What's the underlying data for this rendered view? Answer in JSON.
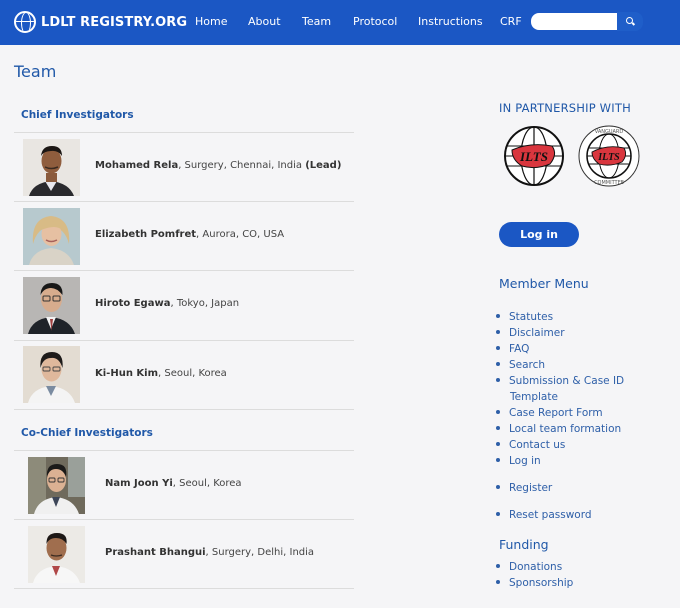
{
  "brand": {
    "title": "LDLT REGISTRY.ORG"
  },
  "nav": {
    "items": [
      {
        "label": "Home"
      },
      {
        "label": "About"
      },
      {
        "label": "Team"
      },
      {
        "label": "Protocol"
      },
      {
        "label": "Instructions"
      },
      {
        "label": "CRF"
      }
    ],
    "search_placeholder": ""
  },
  "page": {
    "title": "Team"
  },
  "chief": {
    "heading": "Chief Investigators",
    "people": [
      {
        "name": "Mohamed Rela",
        "detail": ", Surgery, Chennai, India ",
        "tag": "(Lead)"
      },
      {
        "name": "Elizabeth Pomfret",
        "detail": ", Aurora, CO, USA",
        "tag": ""
      },
      {
        "name": "Hiroto Egawa",
        "detail": ", Tokyo, Japan",
        "tag": ""
      },
      {
        "name": "Ki-Hun Kim",
        "detail": ", Seoul, Korea",
        "tag": ""
      }
    ]
  },
  "cochief": {
    "heading": "Co-Chief Investigators",
    "people": [
      {
        "name": "Nam Joon Yi",
        "detail": ", Seoul, Korea"
      },
      {
        "name": "Prashant Bhangui",
        "detail": ", Surgery, Delhi, India"
      }
    ]
  },
  "partnership": {
    "heading": "IN PARTNERSHIP WITH",
    "logo1_text": "ILTS",
    "logo2_text": "ILTS",
    "logo2_top": "VANGUARD",
    "logo2_bottom": "COMMITTEE"
  },
  "login_button": "Log in",
  "member_menu": {
    "heading": "Member Menu",
    "items": [
      "Statutes",
      "Disclaimer",
      "FAQ",
      "Search",
      "Submission & Case ID",
      "Case Report Form",
      "Local team formation",
      "Contact us",
      "Log in",
      "Register",
      "Reset password"
    ],
    "item4_cont": "Template"
  },
  "funding": {
    "heading": "Funding",
    "items": [
      "Donations",
      "Sponsorship"
    ]
  },
  "colors": {
    "nav": "#1b57c4",
    "accent": "#2058a8",
    "link": "#2e5fa8"
  }
}
